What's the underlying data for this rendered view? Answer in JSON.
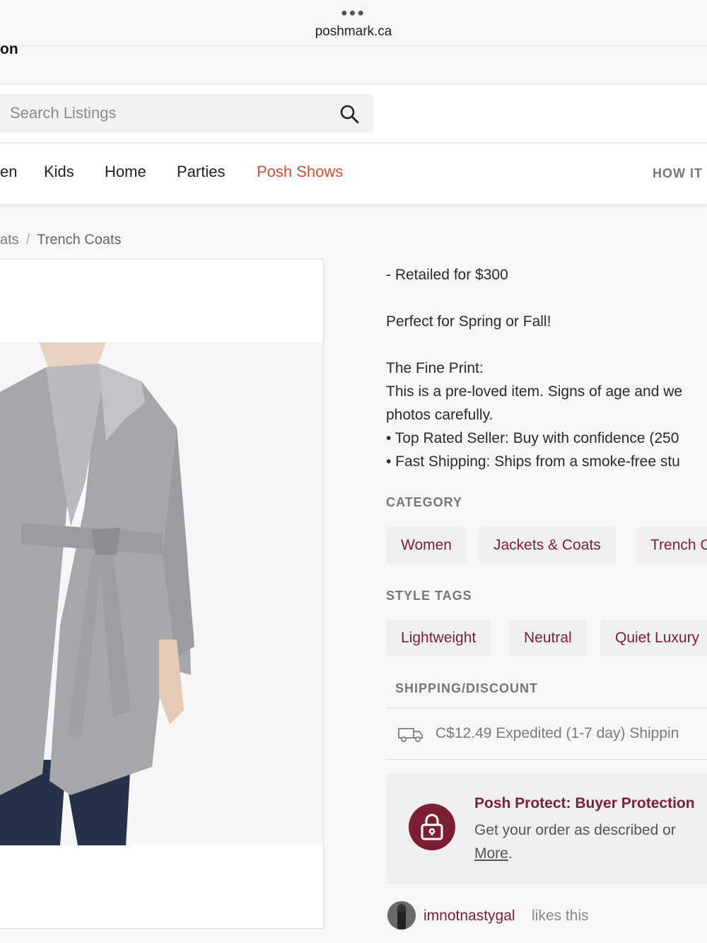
{
  "browser": {
    "url": "poshmark.ca"
  },
  "strip": {
    "text": "on"
  },
  "search": {
    "placeholder": "Search Listings"
  },
  "nav": {
    "items": [
      {
        "label": "en"
      },
      {
        "label": "Kids"
      },
      {
        "label": "Home"
      },
      {
        "label": "Parties"
      },
      {
        "label": "Posh Shows"
      }
    ],
    "how_it": "HOW IT"
  },
  "breadcrumb": {
    "prev": "ats",
    "separator": "/",
    "current": "Trench Coats"
  },
  "description": {
    "retail": "- Retailed for $300",
    "season": "Perfect for Spring or Fall!",
    "fine_print_title": "The Fine Print:",
    "fine_print_line1": "This is a pre-loved item. Signs of age and we",
    "fine_print_line2": "photos carefully.",
    "bullet1": "• Top Rated Seller: Buy with confidence (250",
    "bullet2": "• Fast Shipping: Ships from a smoke-free stu"
  },
  "category": {
    "label": "CATEGORY",
    "chips": [
      "Women",
      "Jackets & Coats",
      "Trench C"
    ]
  },
  "style_tags": {
    "label": "STYLE TAGS",
    "chips": [
      "Lightweight",
      "Neutral",
      "Quiet Luxury"
    ]
  },
  "shipping": {
    "label": "SHIPPING/DISCOUNT",
    "text": "C$12.49 Expedited (1-7 day) Shippin"
  },
  "protect": {
    "title": "Posh Protect: Buyer Protection",
    "line1": "Get your order as described or",
    "more": "More",
    "period": "."
  },
  "likes": {
    "user": "imnotnastygal",
    "tail": "likes this"
  },
  "colors": {
    "accent_nav": "#d64b34",
    "brand_maroon": "#7a1f34"
  }
}
